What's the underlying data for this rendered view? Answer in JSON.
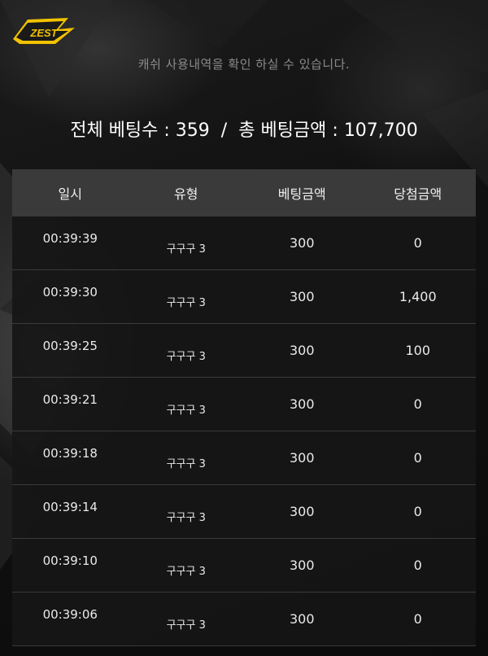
{
  "header": {
    "logo_text": "ZEST",
    "subtitle": "캐쉬 사용내역을 확인 하실 수 있습니다."
  },
  "summary": {
    "total_bets_label": "전체 베팅수 : ",
    "total_bets_value": "359",
    "separator": "/",
    "total_amount_label": "총 베팅금액 : ",
    "total_amount_value": "107,700"
  },
  "table": {
    "headers": [
      "일시",
      "유형",
      "베팅금액",
      "당첨금액"
    ],
    "rows": [
      {
        "time": "00:39:39",
        "type": "구구구 3",
        "bet": "300",
        "win": "0"
      },
      {
        "time": "00:39:30",
        "type": "구구구 3",
        "bet": "300",
        "win": "1,400"
      },
      {
        "time": "00:39:25",
        "type": "구구구 3",
        "bet": "300",
        "win": "100"
      },
      {
        "time": "00:39:21",
        "type": "구구구 3",
        "bet": "300",
        "win": "0"
      },
      {
        "time": "00:39:18",
        "type": "구구구 3",
        "bet": "300",
        "win": "0"
      },
      {
        "time": "00:39:14",
        "type": "구구구 3",
        "bet": "300",
        "win": "0"
      },
      {
        "time": "00:39:10",
        "type": "구구구 3",
        "bet": "300",
        "win": "0"
      },
      {
        "time": "00:39:06",
        "type": "구구구 3",
        "bet": "300",
        "win": "0"
      }
    ]
  },
  "colors": {
    "accent": "#f2c200",
    "header_bg": "#3a3a3a",
    "row_bg": "#161616"
  }
}
